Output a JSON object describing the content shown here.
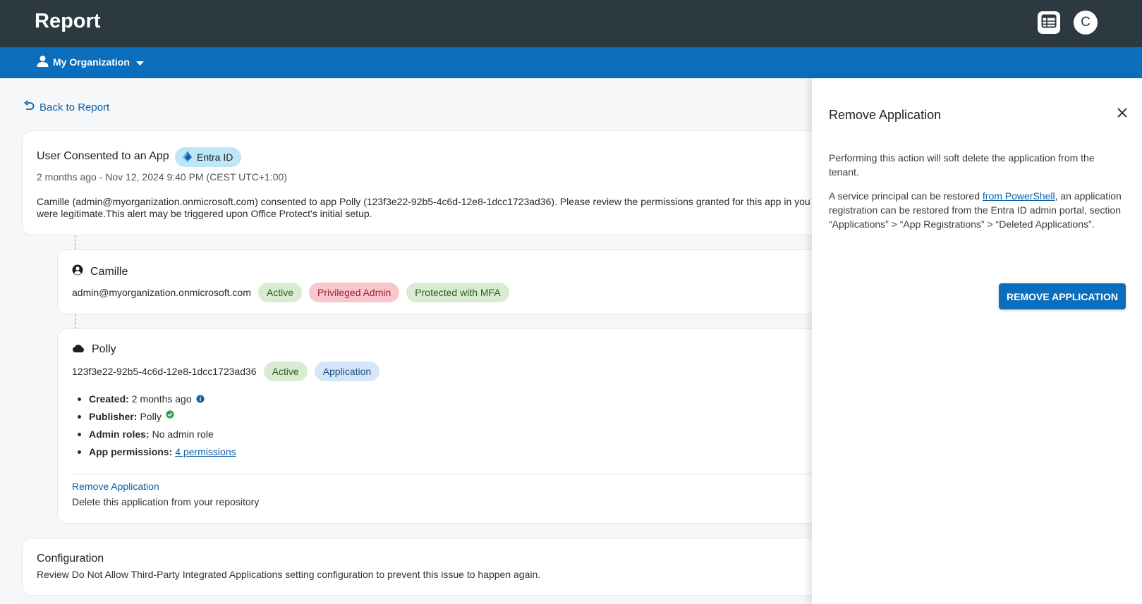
{
  "header": {
    "title": "Report",
    "avatar_initial": "C"
  },
  "org_bar": {
    "org_name": "My Organization"
  },
  "back_link": "Back to Report",
  "event": {
    "title": "User Consented to an App",
    "source_badge": "Entra ID",
    "time": "2 months ago - Nov 12, 2024 9:40 PM (CEST UTC+1:00)",
    "description_line1": "Camille (admin@myorganization.onmicrosoft.com) consented to app Polly (123f3e22-92b5-4c6d-12e8-1dcc1723ad36). Please review the permissions granted for this app in you",
    "description_line2": "were legitimate.This alert may be triggered upon Office Protect's initial setup."
  },
  "user_card": {
    "name": "Camille",
    "email": "admin@myorganization.onmicrosoft.com",
    "badges": [
      "Active",
      "Privileged Admin",
      "Protected with MFA"
    ]
  },
  "app_card": {
    "name": "Polly",
    "app_id": "123f3e22-92b5-4c6d-12e8-1dcc1723ad36",
    "badges": [
      "Active",
      "Application"
    ],
    "details": {
      "created_label": "Created:",
      "created_value": "2 months ago",
      "publisher_label": "Publisher:",
      "publisher_value": "Polly",
      "admin_roles_label": "Admin roles:",
      "admin_roles_value": "No admin role",
      "permissions_label": "App permissions:",
      "permissions_link": "4 permissions"
    },
    "action_link": "Remove Application",
    "action_description": "Delete this application from your repository"
  },
  "configuration": {
    "title": "Configuration",
    "description": "Review Do Not Allow Third-Party Integrated Applications setting configuration to prevent this issue to happen again."
  },
  "drawer": {
    "title": "Remove Application",
    "paragraph1": "Performing this action will soft delete the application from the tenant.",
    "paragraph2_before": "A service principal can be restored ",
    "paragraph2_link": "from PowerShell",
    "paragraph2_after": ", an application registration can be restored from the Entra ID admin portal, section “Applications” > “App Registrations” > “Deleted Applications”.",
    "button_label": "REMOVE APPLICATION"
  },
  "colors": {
    "topbar": "#2d3941",
    "orgbar": "#0a6ebd",
    "link": "#0a5fa8",
    "badge_green": "#d9ecd2",
    "badge_red": "#f8c7cd",
    "badge_blue": "#d4e6f7",
    "badge_entra": "#bde6f7"
  },
  "icons": {
    "calendar": "table-calendar-icon",
    "org": "person-icon",
    "back": "undo-arrow-icon",
    "entra": "entra-id-logo-icon",
    "user": "account-circle-icon",
    "app": "cloud-icon",
    "info": "info-icon",
    "verified": "verified-check-icon",
    "close": "close-icon"
  }
}
